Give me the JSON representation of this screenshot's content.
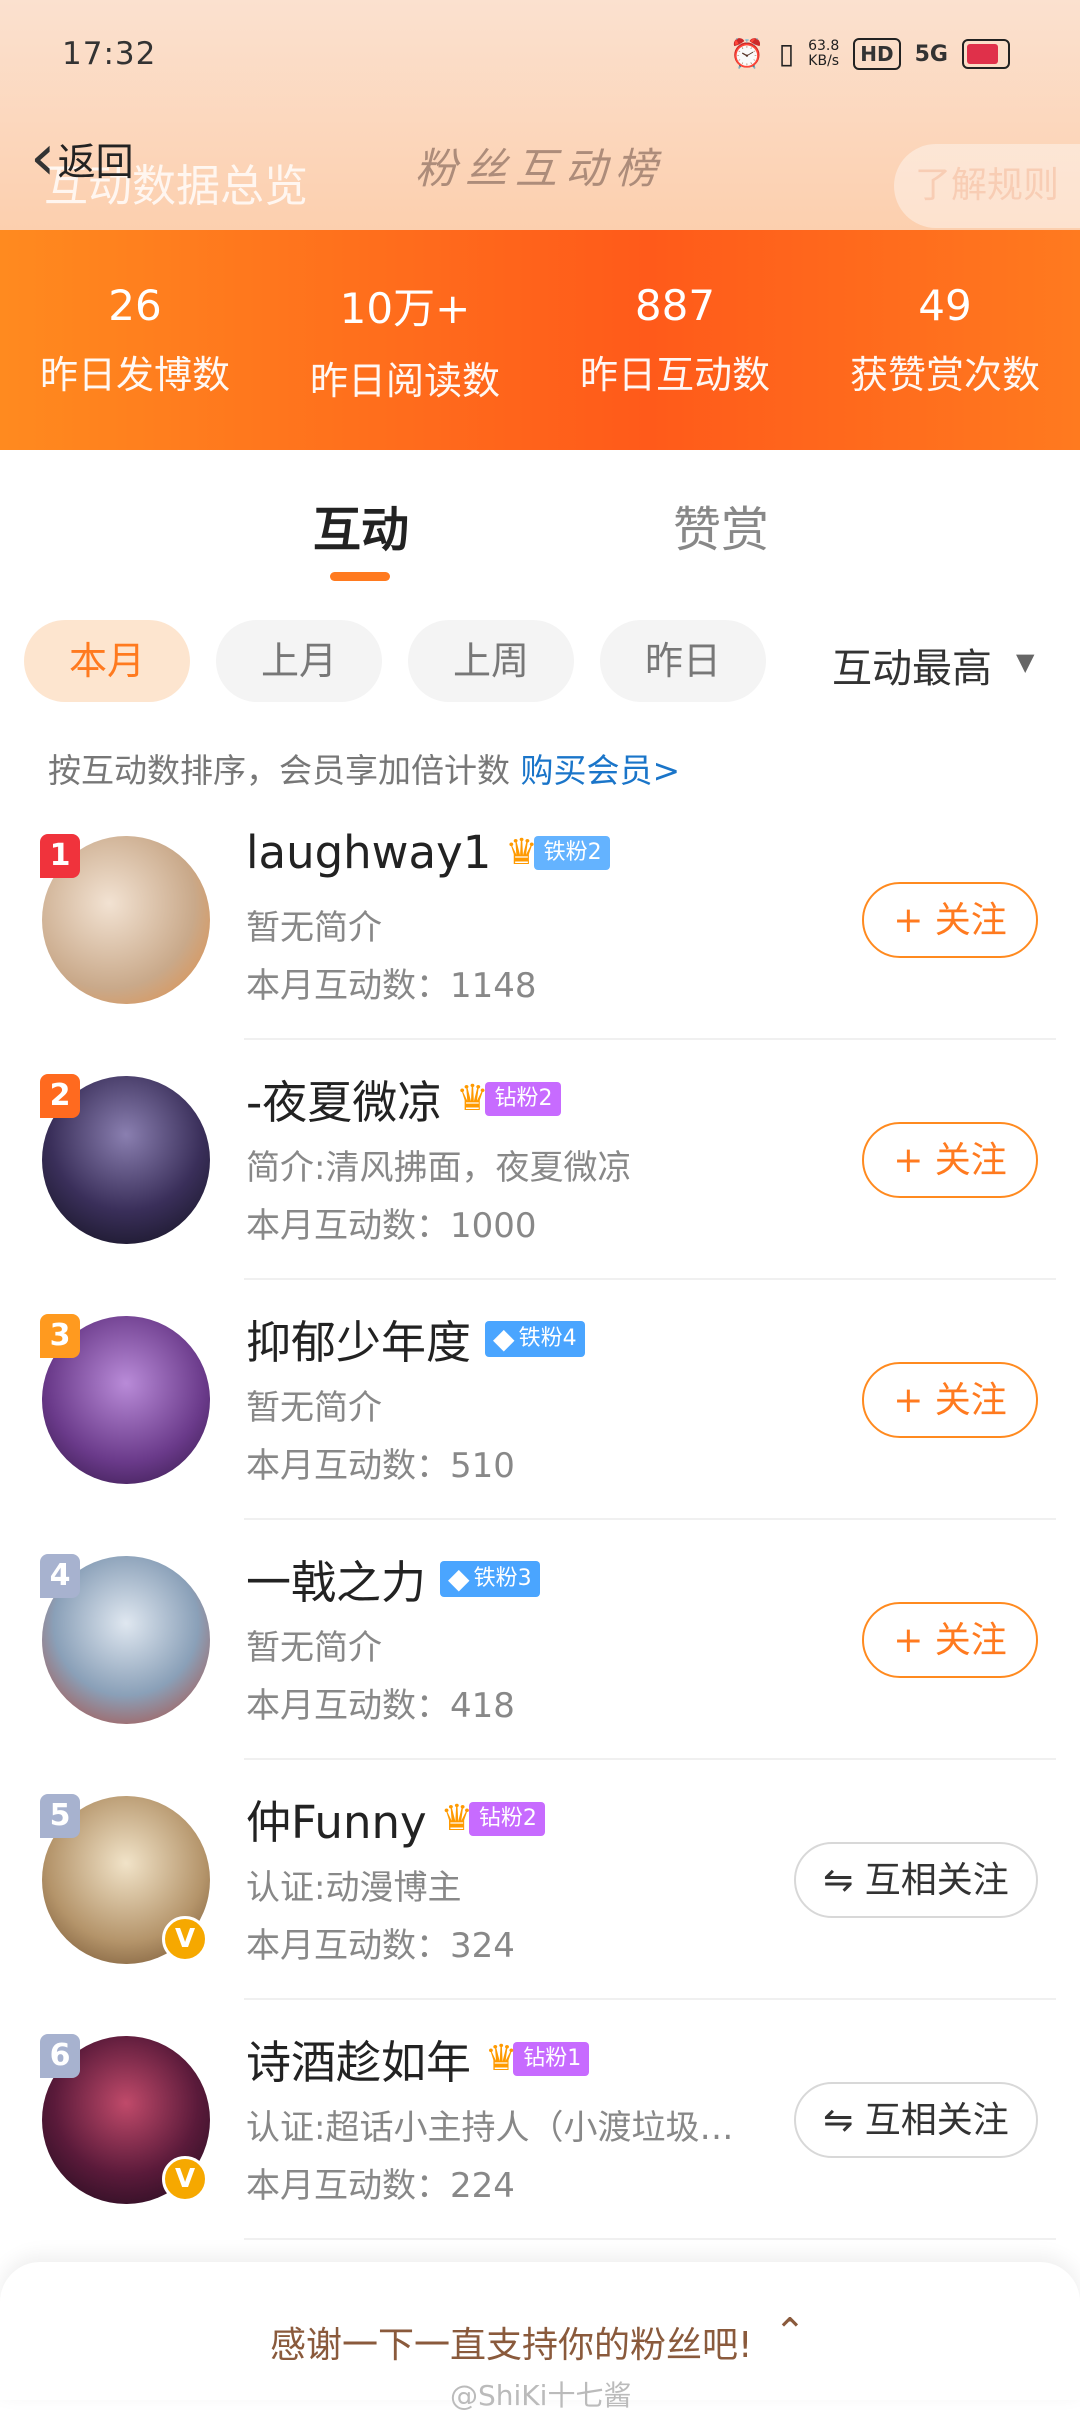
{
  "status_bar": {
    "time": "17:32",
    "net_speed": "63.8\nKB/s",
    "hd": "HD",
    "signal": "5G"
  },
  "header": {
    "back_label": "返回",
    "title": "互动数据总览",
    "watermark_text": "粉丝互动榜",
    "rules_label": "了解规则"
  },
  "stats": [
    {
      "value": "26",
      "label": "昨日发博数"
    },
    {
      "value": "10万+",
      "label": "昨日阅读数"
    },
    {
      "value": "887",
      "label": "昨日互动数"
    },
    {
      "value": "49",
      "label": "获赞赏次数"
    }
  ],
  "tabs": {
    "active": "互动",
    "other": "赞赏"
  },
  "filters": {
    "chips": [
      "本月",
      "上月",
      "上周",
      "昨日"
    ],
    "active_index": 0,
    "sort_label": "互动最高"
  },
  "tip": {
    "text": "按互动数排序，会员享加倍计数 ",
    "link": "购买会员>"
  },
  "fans": [
    {
      "rank": "1",
      "name": "laughway1",
      "badge": "铁粉2",
      "badge_type": "crown-blue",
      "bio": "暂无简介",
      "count": "本月互动数：1148",
      "action": "+ 关注",
      "verified": false
    },
    {
      "rank": "2",
      "name": "-夜夏微凉",
      "badge": "钻粉2",
      "badge_type": "crown-purple",
      "bio": "简介:清风拂面，夜夏微凉",
      "count": "本月互动数：1000",
      "action": "+ 关注",
      "verified": false
    },
    {
      "rank": "3",
      "name": "抑郁少年度",
      "badge": "铁粉4",
      "badge_type": "gem-blue",
      "bio": "暂无简介",
      "count": "本月互动数：510",
      "action": "+ 关注",
      "verified": false
    },
    {
      "rank": "4",
      "name": "一戟之力",
      "badge": "铁粉3",
      "badge_type": "gem-blue",
      "bio": "暂无简介",
      "count": "本月互动数：418",
      "action": "+ 关注",
      "verified": false
    },
    {
      "rank": "5",
      "name": "仲Funny",
      "badge": "钻粉2",
      "badge_type": "crown-purple",
      "bio": "认证:动漫博主",
      "count": "本月互动数：324",
      "action": "⇋ 互相关注",
      "verified": true
    },
    {
      "rank": "6",
      "name": "诗酒趁如年",
      "badge": "钻粉1",
      "badge_type": "crown-purple",
      "bio": "认证:超话小主持人（小渡垃圾…",
      "count": "本月互动数：224",
      "action": "⇋ 互相关注",
      "verified": true
    }
  ],
  "colors": {
    "accent": "#ff7a1f",
    "rank": [
      "#f0333c",
      "#ff6a1f",
      "#ff9a1f",
      "#a7b2cf",
      "#a7b2cf",
      "#a7b2cf"
    ]
  },
  "bottom": {
    "thanks": "感谢一下一直支持你的粉丝吧!",
    "watermark": "@ShiKi十七酱"
  }
}
